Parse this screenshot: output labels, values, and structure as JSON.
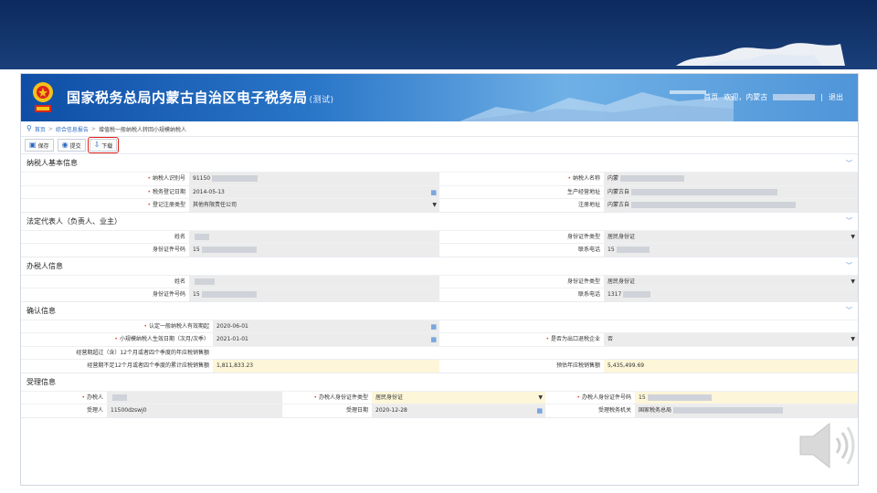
{
  "site": {
    "title": "国家税务总局内蒙古自治区电子税务局",
    "sub": "(测试)",
    "home_link": "首页",
    "welcome": "欢迎，内蒙古",
    "sep": "|",
    "logout": "退出"
  },
  "breadcrumb": {
    "home": "首页",
    "sep1": ">",
    "report": "综合信息报告",
    "sep2": ">",
    "current": "增值税一般纳税人转回小规模纳税人"
  },
  "toolbar": {
    "save": "保存",
    "submit": "提交",
    "download": "下载"
  },
  "sections": {
    "basic": {
      "title": "纳税人基本信息",
      "tax_id_label": "纳税人识别号",
      "tax_id_value": "91150",
      "taxpayer_name_label": "纳税人名称",
      "taxpayer_name_value": "内蒙",
      "reg_date_label": "税务登记日期",
      "reg_date_value": "2014-05-13",
      "biz_addr_label": "生产经营地址",
      "biz_addr_value": "内蒙古自",
      "reg_type_label": "登记注册类型",
      "reg_type_value": "其他有限责任公司",
      "reg_addr_label": "注册地址",
      "reg_addr_value": "内蒙古自"
    },
    "legal": {
      "title": "法定代表人（负责人、业主）",
      "name_label": "姓名",
      "name_value": "",
      "id_type_label": "身份证件类型",
      "id_type_value": "居民身份证",
      "id_no_label": "身份证件号码",
      "id_no_value": "15",
      "phone_label": "联系电话",
      "phone_value": "15"
    },
    "agent": {
      "title": "办税人信息",
      "name_label": "姓名",
      "name_value": "",
      "id_type_label": "身份证件类型",
      "id_type_value": "居民身份证",
      "id_no_label": "身份证件号码",
      "id_no_value": "15",
      "phone_label": "联系电话",
      "phone_value": "1317"
    },
    "confirm": {
      "title": "确认信息",
      "valid_date_label": "认定一般纳税人有效期起",
      "valid_date_value": "2020-06-01",
      "small_date_label": "小规模纳税人生效日期（次月/次季）",
      "small_date_value": "2021-01-01",
      "export_label": "是否为出口退税企业",
      "export_value": "否",
      "over12_label": "经营期超过（含）12个月或者四个季度的年应税销售额",
      "over12_value": "",
      "under12_label": "经营期不足12个月或者四个季度的累计应税销售额",
      "under12_value": "1,811,833.23",
      "annual_label": "预估年应税销售额",
      "annual_value": "5,435,499.69"
    },
    "accept": {
      "title": "受理信息",
      "handler_label": "办税人",
      "handler_value": "",
      "handler_id_type_label": "办税人身份证件类型",
      "handler_id_type_value": "居民身份证",
      "handler_id_no_label": "办税人身份证件号码",
      "handler_id_no_value": "15",
      "receiver_label": "受理人",
      "receiver_value": "11500dzswj0",
      "accept_date_label": "受理日期",
      "accept_date_value": "2020-12-28",
      "office_label": "受理税务机关",
      "office_value": "国家税务总局"
    }
  }
}
